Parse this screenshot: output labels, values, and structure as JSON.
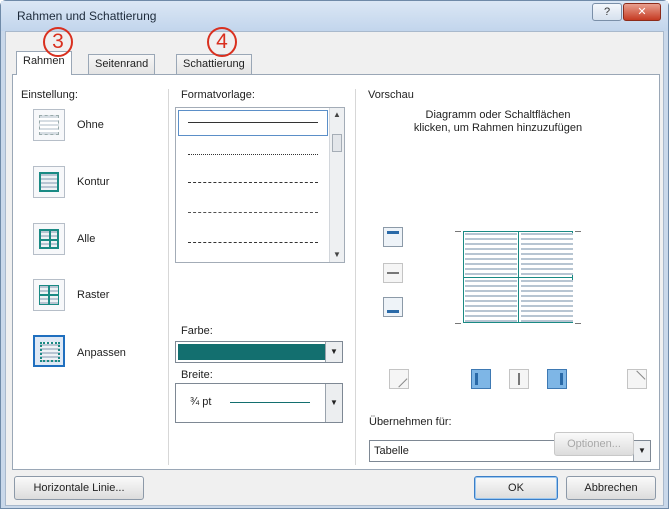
{
  "window": {
    "title": "Rahmen und Schattierung",
    "help_label": "?",
    "close_label": "✕"
  },
  "markers": [
    "3",
    "4"
  ],
  "tabs": [
    {
      "label": "Rahmen"
    },
    {
      "label": "Seitenrand"
    },
    {
      "label": "Schattierung"
    }
  ],
  "einstellung": {
    "label": "Einstellung:",
    "items": [
      {
        "label": "Ohne",
        "icon": "no-border-icon"
      },
      {
        "label": "Kontur",
        "icon": "box-border-icon"
      },
      {
        "label": "Alle",
        "icon": "all-borders-icon"
      },
      {
        "label": "Raster",
        "icon": "grid-border-icon"
      },
      {
        "label": "Anpassen",
        "icon": "custom-border-icon"
      }
    ],
    "selected": "Anpassen"
  },
  "formatvorlage": {
    "label": "Formatvorlage:"
  },
  "farbe": {
    "label": "Farbe:",
    "value_color": "#136f6f"
  },
  "breite": {
    "label": "Breite:",
    "value": "¾ pt"
  },
  "vorschau": {
    "label": "Vorschau",
    "hint": "Diagramm oder Schaltflächen klicken, um Rahmen hinzuzufügen"
  },
  "apply": {
    "label": "Übernehmen für:",
    "value": "Tabelle"
  },
  "buttons": {
    "options": "Optionen...",
    "horizontal_line": "Horizontale Linie...",
    "ok": "OK",
    "cancel": "Abbrechen"
  }
}
